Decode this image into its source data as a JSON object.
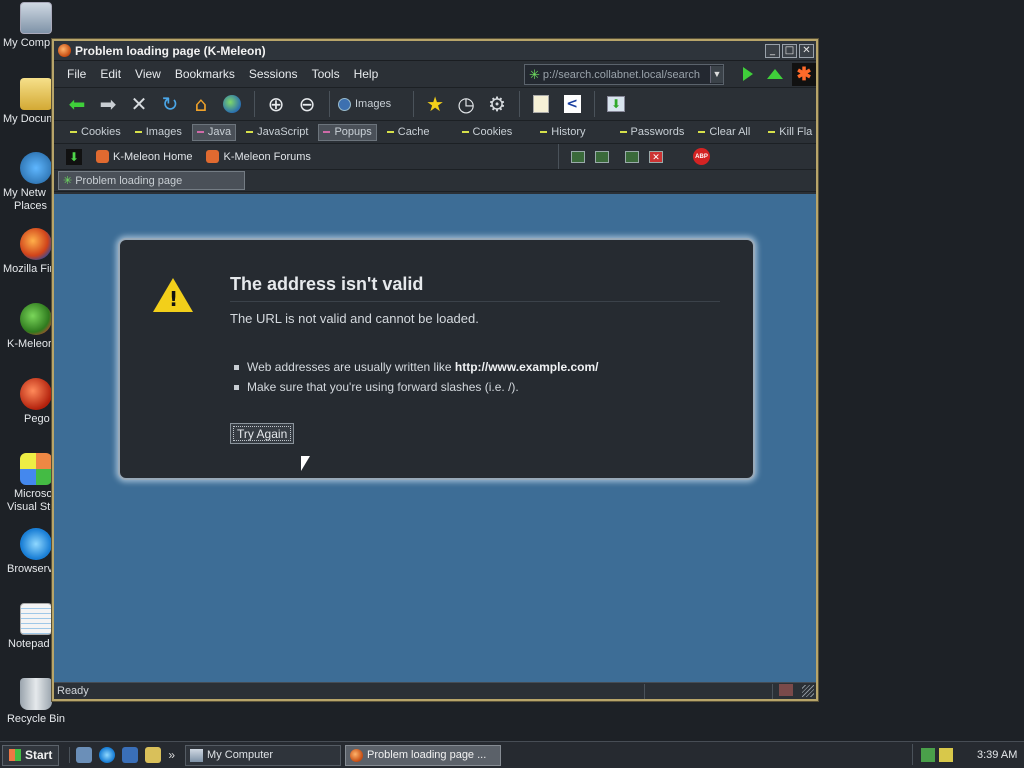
{
  "desktop": {
    "icons": [
      {
        "label": "My Comp",
        "icon": "my-computer-icon"
      },
      {
        "label": "My Docum",
        "icon": "my-documents-icon"
      },
      {
        "label": "My Netw",
        "label2": "Places",
        "icon": "network-places-icon"
      },
      {
        "label": "Mozilla Fir",
        "icon": "firefox-icon"
      },
      {
        "label": "K-Meleor",
        "icon": "k-meleon-icon"
      },
      {
        "label": "Pego",
        "icon": "pego-icon"
      },
      {
        "label": "Microso",
        "label2": "Visual Stu",
        "icon": "visual-studio-icon"
      },
      {
        "label": "Browserv",
        "icon": "internet-explorer-icon"
      },
      {
        "label": "Notepad",
        "icon": "notepad-icon"
      },
      {
        "label": "Recycle Bin",
        "icon": "recycle-bin-icon"
      }
    ]
  },
  "window": {
    "title": "Problem loading page (K-Meleon)",
    "controls": {
      "minimize": "_",
      "maximize": "□",
      "close": "✕"
    }
  },
  "menu": {
    "items": [
      "File",
      "Edit",
      "View",
      "Bookmarks",
      "Sessions",
      "Tools",
      "Help"
    ],
    "underline_index": [
      0,
      0,
      0,
      0,
      0,
      0,
      0
    ]
  },
  "address": {
    "url": "p://search.collabnet.local/search",
    "dropdown": "▼"
  },
  "toolbar": {
    "images_label": "Images",
    "buttons": [
      "back",
      "forward",
      "stop",
      "reload",
      "home",
      "web",
      "zoom-in",
      "zoom-out",
      "bookmarks",
      "history",
      "settings",
      "page-info",
      "view-source",
      "download"
    ]
  },
  "prefbar": {
    "items": [
      {
        "label": "Cookies",
        "on": false
      },
      {
        "label": "Images",
        "on": false
      },
      {
        "label": "Java",
        "on": true
      },
      {
        "label": "JavaScript",
        "on": false
      },
      {
        "label": "Popups",
        "on": true
      },
      {
        "label": "Cache",
        "on": false
      },
      {
        "label": "Cookies",
        "on": false
      },
      {
        "label": "History",
        "on": false
      },
      {
        "label": "Passwords",
        "on": false
      },
      {
        "label": "Clear All",
        "on": false
      },
      {
        "label": "Kill Fla",
        "on": false
      }
    ]
  },
  "bookmarks": {
    "items": [
      "K-Meleon Home",
      "K-Meleon Forums"
    ],
    "abp": "ABP"
  },
  "tab": {
    "label": "Problem loading page"
  },
  "error": {
    "title": "The address isn't valid",
    "description": "The URL is not valid and cannot be loaded.",
    "bullet1_text": "Web addresses are usually written like ",
    "bullet1_bold": "http://www.example.com/",
    "bullet2_text": "Make sure that you're using forward slashes (i.e. /).",
    "button": "Try Again"
  },
  "status": {
    "text": "Ready"
  },
  "taskbar": {
    "start": "Start",
    "more": "»",
    "tasks": [
      {
        "label": "My Computer",
        "active": false
      },
      {
        "label": "Problem loading page ...",
        "active": true
      }
    ],
    "clock": "3:39 AM"
  },
  "colors": {
    "content_bg": "#3d6d96",
    "error_panel": "#262b31",
    "warning": "#f2cf1a",
    "window_border": "#b8a56a"
  }
}
